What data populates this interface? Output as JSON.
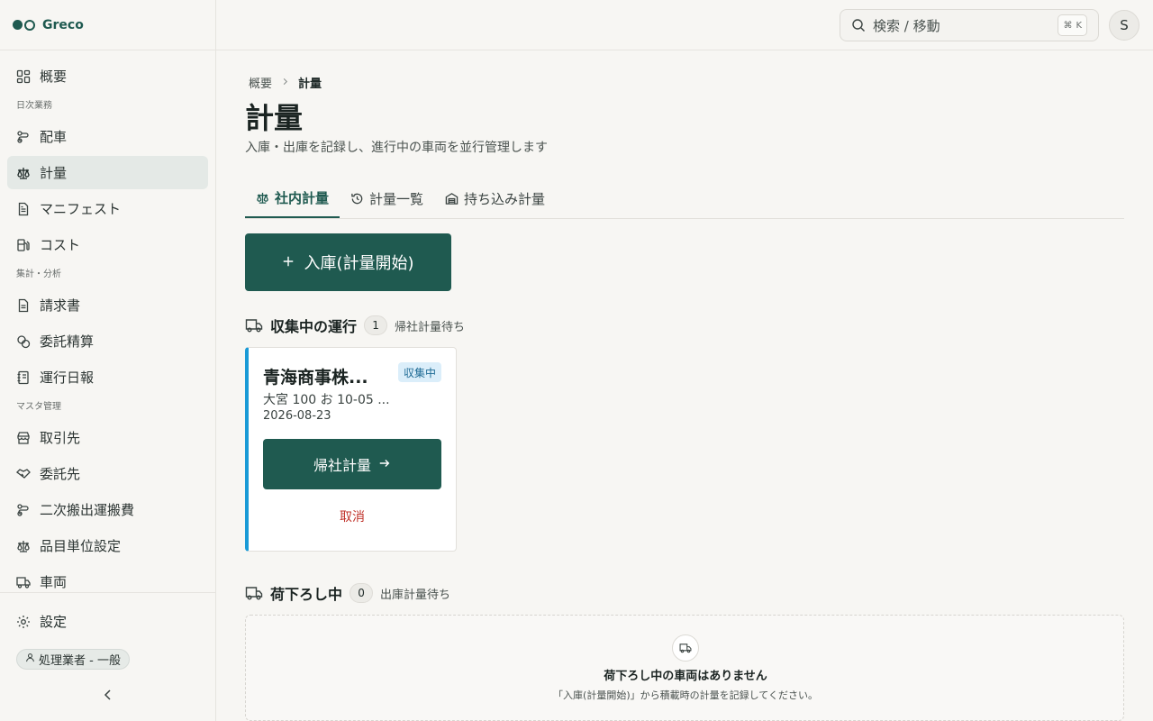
{
  "brand": {
    "name": "Greco"
  },
  "sidebar": {
    "items": [
      {
        "label": "概要"
      },
      {
        "label": "配車"
      },
      {
        "label": "計量"
      },
      {
        "label": "マニフェスト"
      },
      {
        "label": "コスト"
      },
      {
        "label": "請求書"
      },
      {
        "label": "委託精算"
      },
      {
        "label": "運行日報"
      },
      {
        "label": "取引先"
      },
      {
        "label": "委託先"
      },
      {
        "label": "二次搬出運搬費"
      },
      {
        "label": "品目単位設定"
      },
      {
        "label": "車両"
      }
    ],
    "sections": [
      "日次業務",
      "集計・分析",
      "マスタ管理"
    ],
    "settings_label": "設定",
    "role_label": "処理業者 - 一般"
  },
  "header": {
    "search_placeholder": "検索 / 移動",
    "shortcut": {
      "mod": "⌘",
      "key": "K"
    },
    "avatar_initial": "S"
  },
  "breadcrumb": {
    "parent": "概要",
    "current": "計量"
  },
  "page": {
    "title": "計量",
    "subtitle": "入庫・出庫を記録し、進行中の車両を並行管理します"
  },
  "tabs": [
    {
      "label": "社内計量",
      "active": true
    },
    {
      "label": "計量一覧",
      "active": false
    },
    {
      "label": "持ち込み計量",
      "active": false
    }
  ],
  "primary_action": {
    "label": "入庫(計量開始)"
  },
  "collecting": {
    "title": "収集中の運行",
    "count": "1",
    "note": "帰社計量待ち",
    "card": {
      "company": "青海商事株...",
      "status": "収集中",
      "plate": "大宮 100 お 10-05 ...",
      "date": "2026-08-23",
      "action_label": "帰社計量",
      "cancel_label": "取消"
    }
  },
  "unloading": {
    "title": "荷下ろし中",
    "count": "0",
    "note": "出庫計量待ち",
    "empty_title": "荷下ろし中の車両はありません",
    "empty_desc": "「入庫(計量開始)」から積載時の計量を記録してください。"
  },
  "colors": {
    "brand": "#1f5a50",
    "accent_blue": "#1a9ad6",
    "danger": "#c0332b"
  }
}
